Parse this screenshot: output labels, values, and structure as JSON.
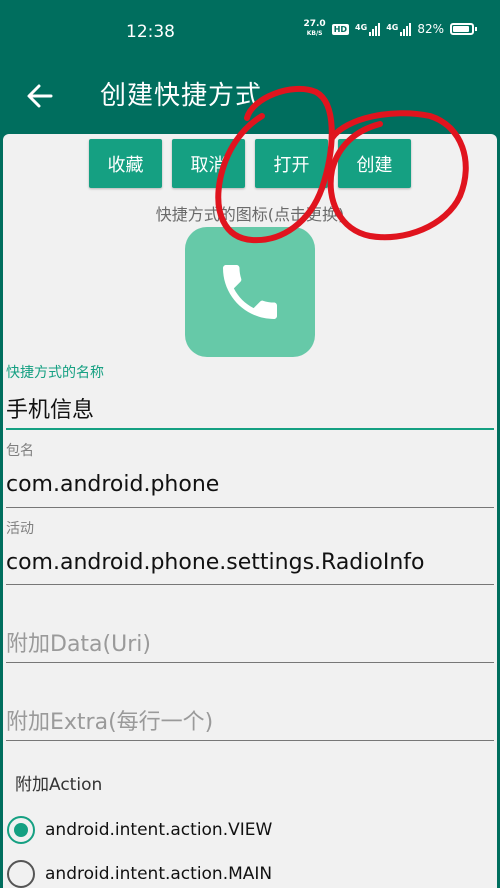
{
  "status_bar": {
    "time": "12:38",
    "net_speed_value": "27.0",
    "net_speed_unit": "KB/S",
    "hd_badge": "HD",
    "sig1_label": "4G",
    "sig2_label": "4G",
    "battery_percent": "82%"
  },
  "toolbar": {
    "title": "创建快捷方式"
  },
  "actions": {
    "favorite": "收藏",
    "cancel": "取消",
    "open": "打开",
    "create": "创建"
  },
  "icon_hint": "快捷方式的图标(点击更换)",
  "fields": {
    "name_label": "快捷方式的名称",
    "name_value": "手机信息",
    "package_label": "包名",
    "package_value": "com.android.phone",
    "activity_label": "活动",
    "activity_value": "com.android.phone.settings.RadioInfo",
    "data_placeholder": "附加Data(Uri)",
    "extra_placeholder": "附加Extra(每行一个)"
  },
  "action_section": {
    "label": "附加Action",
    "options": [
      {
        "label": "android.intent.action.VIEW",
        "checked": true
      },
      {
        "label": "android.intent.action.MAIN",
        "checked": false
      }
    ]
  },
  "colors": {
    "primary_dark": "#006e5e",
    "accent": "#15a082",
    "icon_bg": "#66c9a8",
    "annotation": "#e0141e"
  },
  "icons": {
    "back": "arrow-left-icon",
    "shortcut": "phone-icon"
  }
}
